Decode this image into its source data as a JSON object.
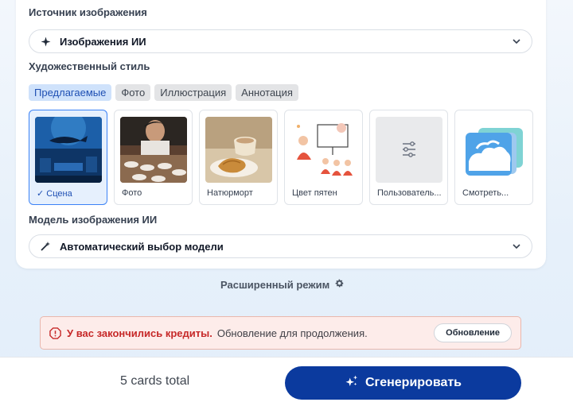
{
  "source": {
    "label": "Источник изображения",
    "value": "Изображения ИИ",
    "icon": "sparkle-icon"
  },
  "style": {
    "label": "Художественный стиль",
    "chips": [
      {
        "label": "Предлагаемые",
        "active": true
      },
      {
        "label": "Фото",
        "active": false
      },
      {
        "label": "Иллюстрация",
        "active": false
      },
      {
        "label": "Аннотация",
        "active": false
      }
    ],
    "cards": [
      {
        "label": "Сцена",
        "selected": true,
        "check": "✓"
      },
      {
        "label": "Фото",
        "selected": false
      },
      {
        "label": "Натюрморт",
        "selected": false
      },
      {
        "label": "Цвет пятен",
        "selected": false
      },
      {
        "label": "Пользователь...",
        "selected": false
      },
      {
        "label": "Смотреть...",
        "selected": false
      }
    ]
  },
  "model": {
    "label": "Модель изображения ИИ",
    "value": "Автоматический выбор модели",
    "icon": "magic-wand-icon"
  },
  "advanced": {
    "label": "Расширенный режим",
    "icon": "gear-icon"
  },
  "alert": {
    "title": "У вас закончились кредиты.",
    "message": "Обновление для продолжения.",
    "button": "Обновление",
    "color": "#c62828"
  },
  "footer": {
    "total": "5 cards total",
    "generate": "Сгенерировать",
    "accent": "#0b3a9e"
  }
}
